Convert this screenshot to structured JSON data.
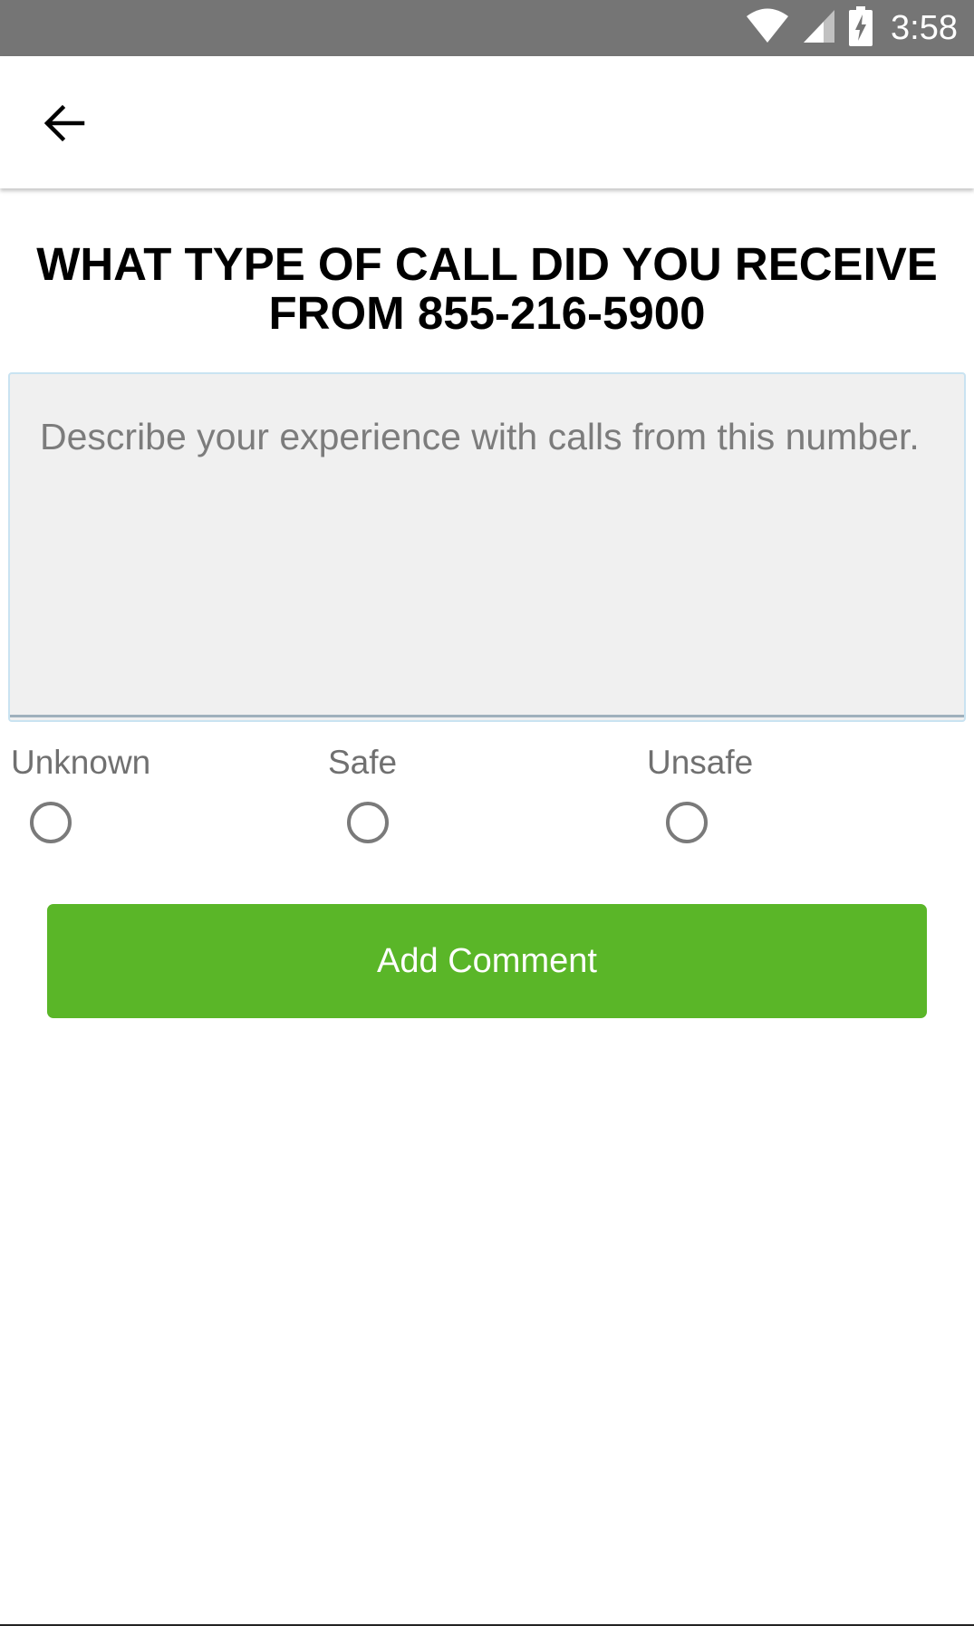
{
  "status_bar": {
    "time": "3:58",
    "icons": [
      "wifi-icon",
      "cellular-signal-icon",
      "battery-charging-icon"
    ]
  },
  "app_bar": {
    "back_icon": "arrow-back-icon"
  },
  "heading": {
    "line1": "WHAT TYPE OF CALL DID YOU RECEIVE",
    "line2": "FROM 855-216-5900"
  },
  "comment": {
    "placeholder": "Describe your experience with calls from this number.",
    "value": ""
  },
  "rating_options": [
    {
      "label": "Unknown",
      "selected": false
    },
    {
      "label": "Safe",
      "selected": false
    },
    {
      "label": "Unsafe",
      "selected": false
    }
  ],
  "submit": {
    "label": "Add Comment"
  },
  "colors": {
    "status_bar": "#757575",
    "button": "#5ab628",
    "textarea_bg": "#f0f0f0",
    "textarea_border": "#c9e3f1"
  }
}
